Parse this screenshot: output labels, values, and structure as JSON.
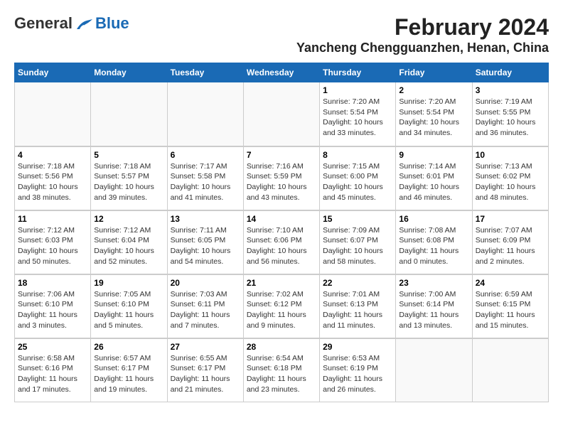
{
  "logo": {
    "general": "General",
    "blue": "Blue"
  },
  "title": {
    "month_year": "February 2024",
    "location": "Yancheng Chengguanzhen, Henan, China"
  },
  "weekdays": [
    "Sunday",
    "Monday",
    "Tuesday",
    "Wednesday",
    "Thursday",
    "Friday",
    "Saturday"
  ],
  "weeks": [
    [
      {
        "day": "",
        "sunrise": "",
        "sunset": "",
        "daylight": ""
      },
      {
        "day": "",
        "sunrise": "",
        "sunset": "",
        "daylight": ""
      },
      {
        "day": "",
        "sunrise": "",
        "sunset": "",
        "daylight": ""
      },
      {
        "day": "",
        "sunrise": "",
        "sunset": "",
        "daylight": ""
      },
      {
        "day": "1",
        "sunrise": "Sunrise: 7:20 AM",
        "sunset": "Sunset: 5:54 PM",
        "daylight": "Daylight: 10 hours and 33 minutes."
      },
      {
        "day": "2",
        "sunrise": "Sunrise: 7:20 AM",
        "sunset": "Sunset: 5:54 PM",
        "daylight": "Daylight: 10 hours and 34 minutes."
      },
      {
        "day": "3",
        "sunrise": "Sunrise: 7:19 AM",
        "sunset": "Sunset: 5:55 PM",
        "daylight": "Daylight: 10 hours and 36 minutes."
      }
    ],
    [
      {
        "day": "4",
        "sunrise": "Sunrise: 7:18 AM",
        "sunset": "Sunset: 5:56 PM",
        "daylight": "Daylight: 10 hours and 38 minutes."
      },
      {
        "day": "5",
        "sunrise": "Sunrise: 7:18 AM",
        "sunset": "Sunset: 5:57 PM",
        "daylight": "Daylight: 10 hours and 39 minutes."
      },
      {
        "day": "6",
        "sunrise": "Sunrise: 7:17 AM",
        "sunset": "Sunset: 5:58 PM",
        "daylight": "Daylight: 10 hours and 41 minutes."
      },
      {
        "day": "7",
        "sunrise": "Sunrise: 7:16 AM",
        "sunset": "Sunset: 5:59 PM",
        "daylight": "Daylight: 10 hours and 43 minutes."
      },
      {
        "day": "8",
        "sunrise": "Sunrise: 7:15 AM",
        "sunset": "Sunset: 6:00 PM",
        "daylight": "Daylight: 10 hours and 45 minutes."
      },
      {
        "day": "9",
        "sunrise": "Sunrise: 7:14 AM",
        "sunset": "Sunset: 6:01 PM",
        "daylight": "Daylight: 10 hours and 46 minutes."
      },
      {
        "day": "10",
        "sunrise": "Sunrise: 7:13 AM",
        "sunset": "Sunset: 6:02 PM",
        "daylight": "Daylight: 10 hours and 48 minutes."
      }
    ],
    [
      {
        "day": "11",
        "sunrise": "Sunrise: 7:12 AM",
        "sunset": "Sunset: 6:03 PM",
        "daylight": "Daylight: 10 hours and 50 minutes."
      },
      {
        "day": "12",
        "sunrise": "Sunrise: 7:12 AM",
        "sunset": "Sunset: 6:04 PM",
        "daylight": "Daylight: 10 hours and 52 minutes."
      },
      {
        "day": "13",
        "sunrise": "Sunrise: 7:11 AM",
        "sunset": "Sunset: 6:05 PM",
        "daylight": "Daylight: 10 hours and 54 minutes."
      },
      {
        "day": "14",
        "sunrise": "Sunrise: 7:10 AM",
        "sunset": "Sunset: 6:06 PM",
        "daylight": "Daylight: 10 hours and 56 minutes."
      },
      {
        "day": "15",
        "sunrise": "Sunrise: 7:09 AM",
        "sunset": "Sunset: 6:07 PM",
        "daylight": "Daylight: 10 hours and 58 minutes."
      },
      {
        "day": "16",
        "sunrise": "Sunrise: 7:08 AM",
        "sunset": "Sunset: 6:08 PM",
        "daylight": "Daylight: 11 hours and 0 minutes."
      },
      {
        "day": "17",
        "sunrise": "Sunrise: 7:07 AM",
        "sunset": "Sunset: 6:09 PM",
        "daylight": "Daylight: 11 hours and 2 minutes."
      }
    ],
    [
      {
        "day": "18",
        "sunrise": "Sunrise: 7:06 AM",
        "sunset": "Sunset: 6:10 PM",
        "daylight": "Daylight: 11 hours and 3 minutes."
      },
      {
        "day": "19",
        "sunrise": "Sunrise: 7:05 AM",
        "sunset": "Sunset: 6:10 PM",
        "daylight": "Daylight: 11 hours and 5 minutes."
      },
      {
        "day": "20",
        "sunrise": "Sunrise: 7:03 AM",
        "sunset": "Sunset: 6:11 PM",
        "daylight": "Daylight: 11 hours and 7 minutes."
      },
      {
        "day": "21",
        "sunrise": "Sunrise: 7:02 AM",
        "sunset": "Sunset: 6:12 PM",
        "daylight": "Daylight: 11 hours and 9 minutes."
      },
      {
        "day": "22",
        "sunrise": "Sunrise: 7:01 AM",
        "sunset": "Sunset: 6:13 PM",
        "daylight": "Daylight: 11 hours and 11 minutes."
      },
      {
        "day": "23",
        "sunrise": "Sunrise: 7:00 AM",
        "sunset": "Sunset: 6:14 PM",
        "daylight": "Daylight: 11 hours and 13 minutes."
      },
      {
        "day": "24",
        "sunrise": "Sunrise: 6:59 AM",
        "sunset": "Sunset: 6:15 PM",
        "daylight": "Daylight: 11 hours and 15 minutes."
      }
    ],
    [
      {
        "day": "25",
        "sunrise": "Sunrise: 6:58 AM",
        "sunset": "Sunset: 6:16 PM",
        "daylight": "Daylight: 11 hours and 17 minutes."
      },
      {
        "day": "26",
        "sunrise": "Sunrise: 6:57 AM",
        "sunset": "Sunset: 6:17 PM",
        "daylight": "Daylight: 11 hours and 19 minutes."
      },
      {
        "day": "27",
        "sunrise": "Sunrise: 6:55 AM",
        "sunset": "Sunset: 6:17 PM",
        "daylight": "Daylight: 11 hours and 21 minutes."
      },
      {
        "day": "28",
        "sunrise": "Sunrise: 6:54 AM",
        "sunset": "Sunset: 6:18 PM",
        "daylight": "Daylight: 11 hours and 23 minutes."
      },
      {
        "day": "29",
        "sunrise": "Sunrise: 6:53 AM",
        "sunset": "Sunset: 6:19 PM",
        "daylight": "Daylight: 11 hours and 26 minutes."
      },
      {
        "day": "",
        "sunrise": "",
        "sunset": "",
        "daylight": ""
      },
      {
        "day": "",
        "sunrise": "",
        "sunset": "",
        "daylight": ""
      }
    ]
  ]
}
